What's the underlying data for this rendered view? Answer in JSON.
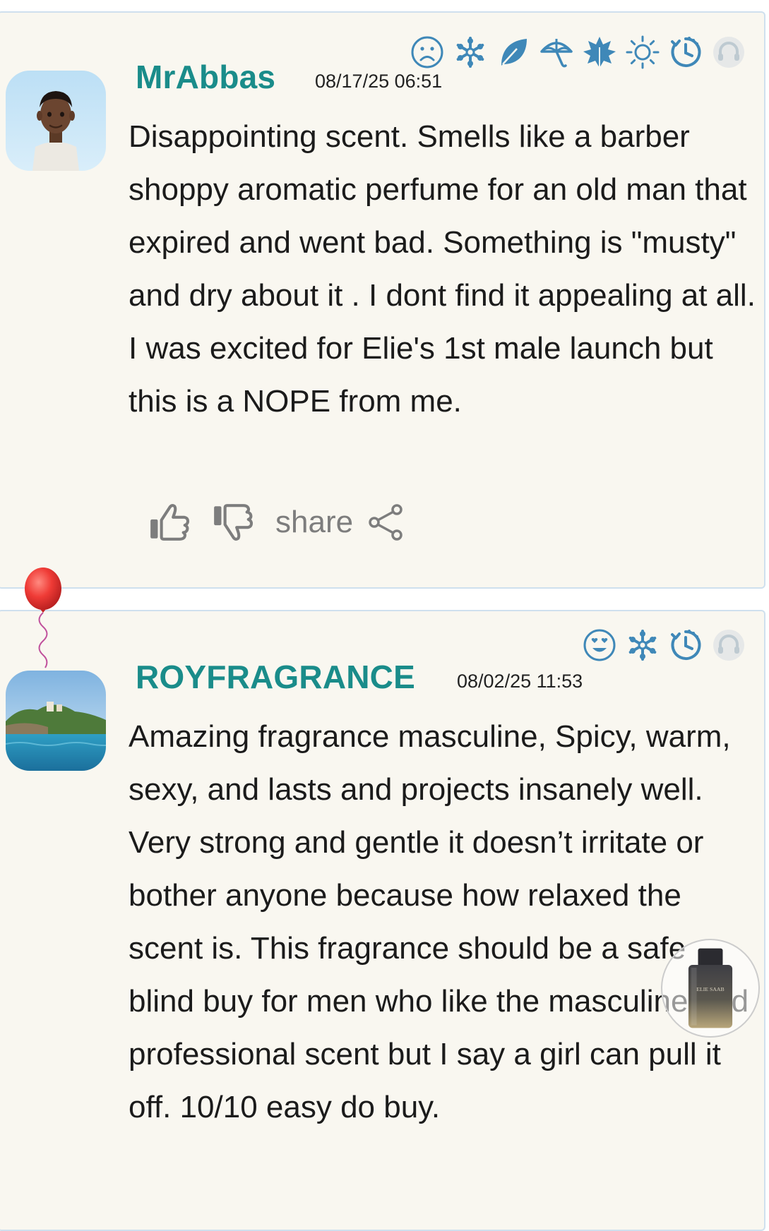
{
  "reviews": [
    {
      "username": "MrAbbas",
      "date": "08/17/25 06:51",
      "text": "Disappointing scent. Smells like a barber shoppy aromatic perfume for an old man that expired and went bad. Something is \"musty\" and dry about it . I dont find it appealing at all. I was excited for Elie's 1st male launch but this is a NOPE from me.",
      "icons": [
        "sad-face-icon",
        "snowflake-icon",
        "leaf-icon",
        "umbrella-icon",
        "autumn-leaf-icon",
        "sun-icon",
        "clock-icon",
        "headphones-icon"
      ]
    },
    {
      "username": "ROYFRAGRANCE",
      "date": "08/02/25 11:53",
      "text": "Amazing fragrance masculine, Spicy, warm, sexy, and lasts and projects insanely well. Very strong and gentle it doesn’t irritate or bother anyone because how relaxed the scent is. This fragrance should be a safe blind buy for men who like the masculine and professional scent but I say a girl can pull it off. 10/10 easy do buy.",
      "icons": [
        "love-face-icon",
        "snowflake-icon",
        "clock-icon",
        "headphones-icon"
      ]
    }
  ],
  "actions": {
    "share_label": "share"
  },
  "product_thumb": {
    "brand_text": "ELIE SAAB"
  },
  "colors": {
    "accent": "#1a8c8a",
    "icon_blue": "#3f88b8",
    "card_bg": "#f9f7f0",
    "card_border": "#cfe0ee",
    "action_gray": "#7d7d7d"
  }
}
